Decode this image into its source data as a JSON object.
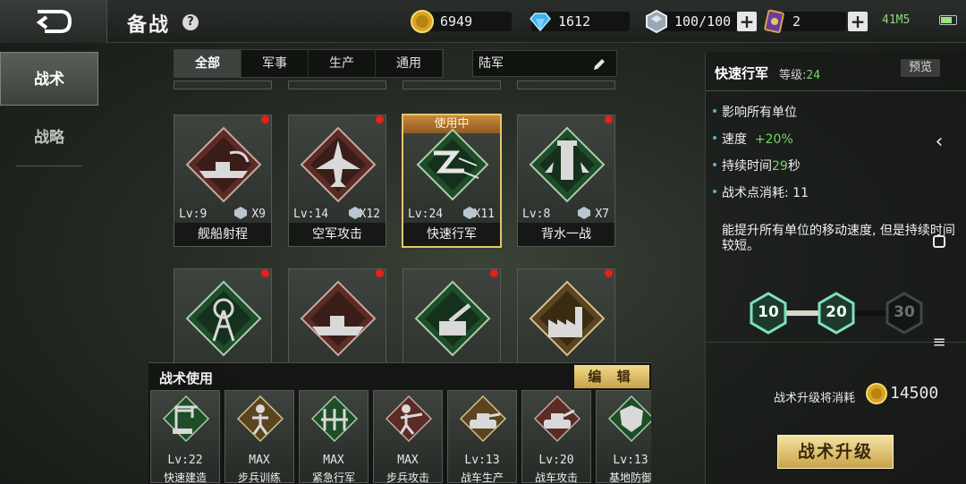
{
  "header": {
    "title": "备战",
    "help_glyph": "?",
    "gold": "6949",
    "diamond": "1612",
    "energy": "100/100",
    "cards": "2",
    "status": "41M5"
  },
  "side_tabs": [
    "战术",
    "战略"
  ],
  "filters": [
    "全部",
    "军事",
    "生产",
    "通用"
  ],
  "search_value": "陆军",
  "cards": [
    {
      "name": "舰船射程",
      "lv": "Lv:9",
      "count": "X9"
    },
    {
      "name": "空军攻击",
      "lv": "Lv:14",
      "count": "X12"
    },
    {
      "name": "快速行军",
      "lv": "Lv:24",
      "count": "X11",
      "badge": "使用中"
    },
    {
      "name": "背水一战",
      "lv": "Lv:8",
      "count": "X7"
    }
  ],
  "usage": {
    "title": "战术使用",
    "edit": "编 辑",
    "slots": [
      {
        "lv": "Lv:22",
        "name": "快速建造"
      },
      {
        "lv": "MAX",
        "name": "步兵训练"
      },
      {
        "lv": "MAX",
        "name": "紧急行军"
      },
      {
        "lv": "MAX",
        "name": "步兵攻击"
      },
      {
        "lv": "Lv:13",
        "name": "战车生产"
      },
      {
        "lv": "Lv:20",
        "name": "战车攻击"
      },
      {
        "lv": "Lv:13",
        "name": "基地防御"
      }
    ]
  },
  "detail": {
    "name": "快速行军",
    "level_label": "等级:",
    "level_value": "24",
    "preview": "预览",
    "stat1": "影响所有单位",
    "stat2_label": "速度",
    "stat2_value": "+20%",
    "stat3_label": "持续时间",
    "stat3_value": "29",
    "stat3_unit": "秒",
    "stat4": "战术点消耗: 11",
    "description": "能提升所有单位的移动速度, 但是持续时间较短。",
    "milestones": [
      "10",
      "20",
      "30"
    ],
    "cost_label": "战术升级将消耗",
    "cost_value": "14500",
    "upgrade": "战术升级"
  },
  "colors": {
    "accent_gold": "#c9a24a",
    "green": "#7ad36a",
    "badge_red": "#e5211b"
  },
  "icons": {
    "back": "back-arrow-icon",
    "gold": "gold-coin-icon",
    "diamond": "diamond-icon",
    "energy": "energy-crystal-icon",
    "cards": "purple-card-icon",
    "edit": "pencil-icon"
  }
}
